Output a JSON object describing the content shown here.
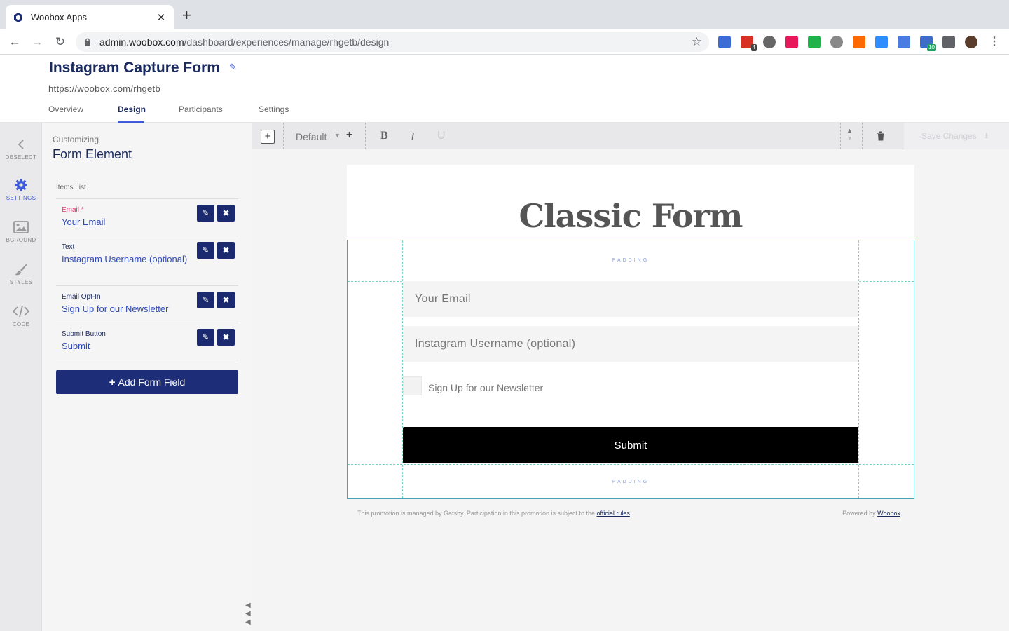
{
  "browser": {
    "tab_title": "Woobox Apps",
    "tab_close": "✕",
    "new_tab": "+",
    "url_host": "admin.woobox.com",
    "url_path": "/dashboard/experiences/manage/rhgetb/design",
    "star": "☆",
    "extensions": [
      {
        "name": "ext-1",
        "color": "#3c6bd6",
        "badge": ""
      },
      {
        "name": "ext-2",
        "color": "#d93025",
        "badge": "4"
      },
      {
        "name": "ext-3",
        "color": "#666666",
        "badge": ""
      },
      {
        "name": "ext-4",
        "color": "#e8195a",
        "badge": ""
      },
      {
        "name": "ext-5",
        "color": "#1fb14a",
        "badge": ""
      },
      {
        "name": "ext-6",
        "color": "#888888",
        "badge": ""
      },
      {
        "name": "ext-7",
        "color": "#ff6a00",
        "badge": ""
      },
      {
        "name": "ext-8",
        "color": "#2d8cff",
        "badge": ""
      },
      {
        "name": "ext-9",
        "color": "#4a7be0",
        "badge": ""
      },
      {
        "name": "ext-10",
        "color": "#3d6cc9",
        "badge": "10"
      },
      {
        "name": "ext-11",
        "color": "#5f6368",
        "badge": ""
      },
      {
        "name": "ext-12",
        "color": "#5a3d2b",
        "badge": ""
      }
    ]
  },
  "header": {
    "title": "Instagram Capture Form",
    "url": "https://woobox.com/rhgetb",
    "tabs": [
      {
        "label": "Overview"
      },
      {
        "label": "Design"
      },
      {
        "label": "Participants"
      },
      {
        "label": "Settings"
      }
    ]
  },
  "rail": {
    "items": [
      {
        "label": "DESELECT"
      },
      {
        "label": "SETTINGS"
      },
      {
        "label": "BGROUND"
      },
      {
        "label": "STYLES"
      },
      {
        "label": "CODE"
      }
    ]
  },
  "panel": {
    "customizing_label": "Customizing",
    "title": "Form Element",
    "items_label": "Items List",
    "items": [
      {
        "type": "Email *",
        "value": "Your Email"
      },
      {
        "type": "Text",
        "value": "Instagram Username (optional)"
      },
      {
        "type": "Email Opt-In",
        "value": "Sign Up for our Newsletter"
      },
      {
        "type": "Submit Button",
        "value": "Submit"
      }
    ],
    "add_button": "Add Form Field",
    "add_plus": "+"
  },
  "editor": {
    "style_name": "Default",
    "bold": "B",
    "italic": "I",
    "underline": "U",
    "save_label": "Save Changes"
  },
  "form": {
    "heading": "Classic Form",
    "padding_label": "PADDING",
    "email_placeholder": "Your Email",
    "username_placeholder": "Instagram Username (optional)",
    "optin_label": "Sign Up for our Newsletter",
    "submit_label": "Submit",
    "footer_text": "This promotion is managed by Gatsby. Participation in this promotion is subject to the ",
    "footer_link": "official rules",
    "footer_end": ".",
    "powered_text": "Powered by ",
    "powered_link": "Woobox"
  }
}
